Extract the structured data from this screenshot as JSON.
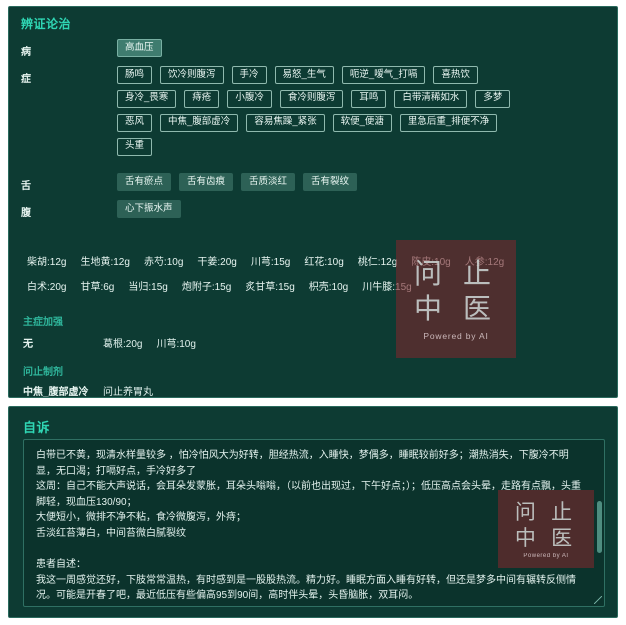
{
  "diagnosis": {
    "title": "辨证论治",
    "rows": [
      {
        "label": "病",
        "chips": [
          [
            "高血压"
          ]
        ]
      },
      {
        "label": "症",
        "chips": [
          [
            "肠鸣",
            "饮冷则腹泻",
            "手冷",
            "易怒_生气",
            "呃逆_嗳气_打嗝",
            "喜热饮"
          ],
          [
            "身冷_畏寒",
            "痔疮",
            "小腹冷",
            "食冷则腹泻",
            "耳鸣",
            "白带清稀如水",
            "多梦"
          ],
          [
            "恶风",
            "中焦_腹部虚冷",
            "容易焦躁_紧张",
            "软便_便溏",
            "里急后重_排便不净"
          ],
          [
            "头重"
          ]
        ]
      },
      {
        "label": "舌",
        "chips": [
          [
            "舌有瘀点",
            "舌有齿痕",
            "舌质淡红",
            "舌有裂纹"
          ]
        ]
      },
      {
        "label": "腹",
        "chips": [
          [
            "心下振水声"
          ]
        ]
      }
    ]
  },
  "prescription": {
    "line1": [
      "柴胡:12g",
      "生地黄:12g",
      "赤芍:10g",
      "干姜:20g",
      "川芎:15g",
      "红花:10g",
      "桃仁:12g",
      "陈皮:10g",
      "人参:12g"
    ],
    "line2": [
      "白术:20g",
      "甘草:6g",
      "当归:15g",
      "炮附子:15g",
      "炙甘草:15g",
      "枳壳:10g",
      "川牛膝:15g"
    ]
  },
  "main_enhance": {
    "title": "主症加强",
    "key": "无",
    "herbs": [
      "葛根:20g",
      "川芎:10g"
    ]
  },
  "wenzhi_formula": {
    "title": "问止制剂",
    "key": "中焦_腹部虚冷",
    "value": "问止养胃丸"
  },
  "watermark": {
    "line1": "问 止",
    "line2": "中 医",
    "sub": "Powered by AI"
  },
  "complaint": {
    "title": "自诉",
    "text": "白带已不黄，现清水样量较多 ，怕冷怕风大为好转，胆经热流，入睡快，梦偶多，睡眠较前好多；潮热消失，下腹冷不明显，无口渴；打嗝好点，手冷好多了\n这周：自己不能大声说话，会耳朵发蒙胀，耳朵头嗡嗡，（以前也出现过，下午好点；）；低压高点会头晕，走路有点飘，头重脚轻，现血压130/90；\n大便短小，微排不净不粘，食冷微腹泻，外痔；\n舌淡红苔薄白，中间苔微白腻裂纹\n\n患者自述：\n我这一周感觉还好，下肢常常温热，有时感到是一股股热流。精力好。睡眠方面入睡有好转，但还是梦多中间有辗转反侧情况。可能是开春了吧，最近低压有些偏高95到90间，高时伴头晕，头昏脑胀，双耳闷。"
  }
}
